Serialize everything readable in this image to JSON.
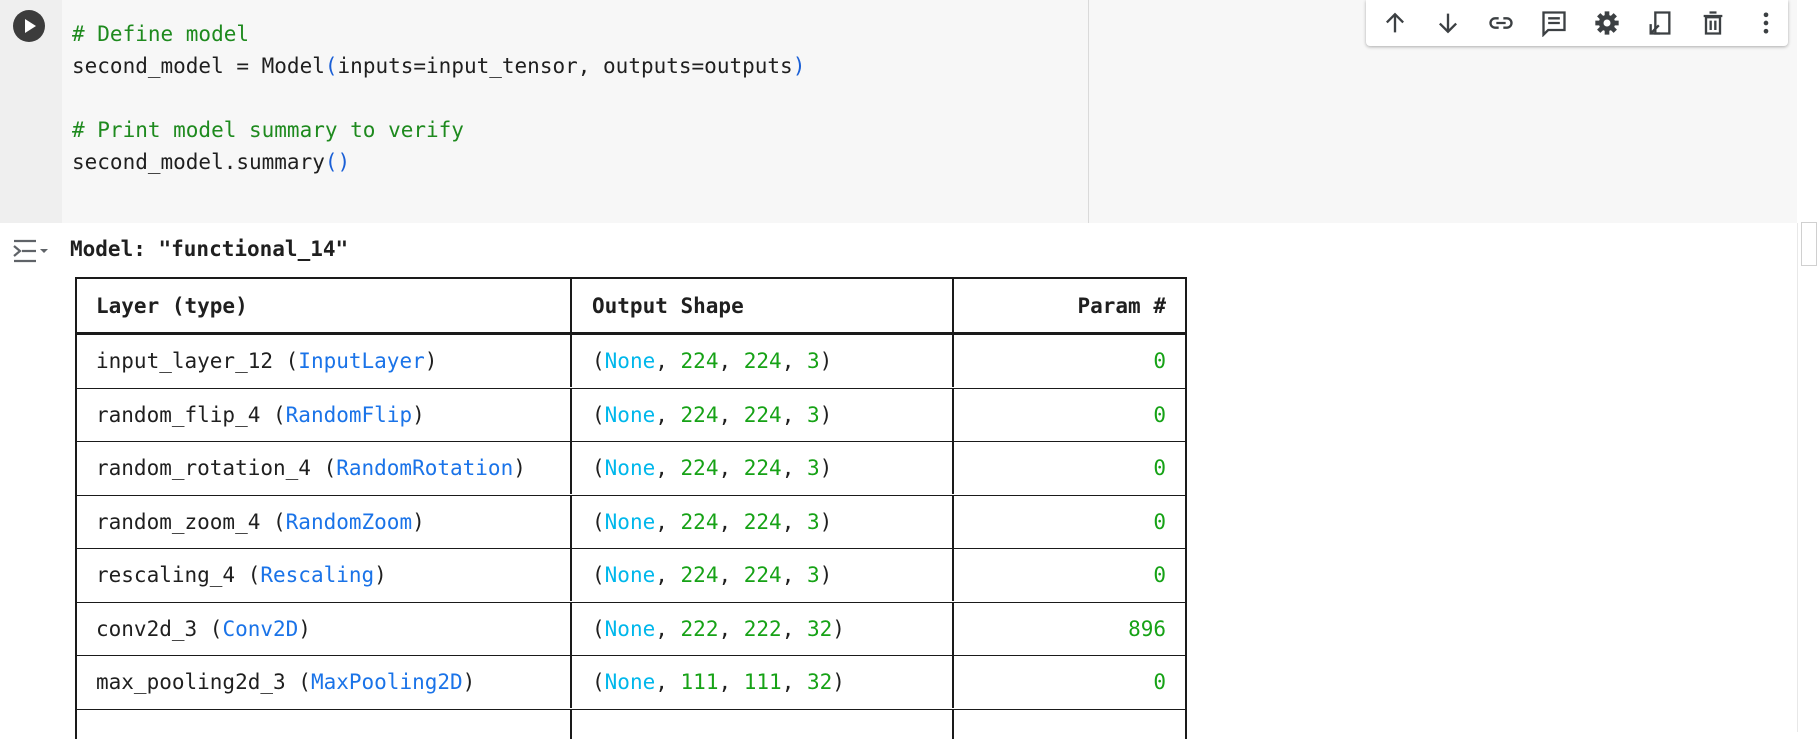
{
  "code_cell": {
    "lines": [
      {
        "comment": "# Define model"
      },
      {
        "pre": "second_model = Model",
        "open": "(",
        "args": "inputs=input_tensor, outputs=outputs",
        "close": ")"
      },
      {
        "text": ""
      },
      {
        "comment": "# Print model summary to verify"
      },
      {
        "pre": "second_model.summary",
        "open": "(",
        "close": ")"
      }
    ]
  },
  "toolbar": {
    "icons": [
      "arrow-up-icon",
      "arrow-down-icon",
      "link-icon",
      "comment-icon",
      "gear-icon",
      "mirror-cell-icon",
      "trash-icon",
      "more-vert-icon"
    ]
  },
  "output": {
    "model_title": "Model: \"functional_14\"",
    "columns": [
      "Layer (type)",
      "Output Shape",
      "Param #"
    ],
    "rows": [
      {
        "name": "input_layer_12",
        "type": "InputLayer",
        "shape": [
          "None",
          "224",
          "224",
          "3"
        ],
        "params": "0"
      },
      {
        "name": "random_flip_4",
        "type": "RandomFlip",
        "shape": [
          "None",
          "224",
          "224",
          "3"
        ],
        "params": "0"
      },
      {
        "name": "random_rotation_4",
        "type": "RandomRotation",
        "shape": [
          "None",
          "224",
          "224",
          "3"
        ],
        "params": "0"
      },
      {
        "name": "random_zoom_4",
        "type": "RandomZoom",
        "shape": [
          "None",
          "224",
          "224",
          "3"
        ],
        "params": "0"
      },
      {
        "name": "rescaling_4",
        "type": "Rescaling",
        "shape": [
          "None",
          "224",
          "224",
          "3"
        ],
        "params": "0"
      },
      {
        "name": "conv2d_3",
        "type": "Conv2D",
        "shape": [
          "None",
          "222",
          "222",
          "32"
        ],
        "params": "896"
      },
      {
        "name": "max_pooling2d_3",
        "type": "MaxPooling2D",
        "shape": [
          "None",
          "111",
          "111",
          "32"
        ],
        "params": "0"
      }
    ]
  },
  "colors": {
    "comment": "#1e8a1e",
    "paren": "#1a5fd6",
    "layer_type": "#1a73e8",
    "none_keyword": "#00b7eb",
    "number": "#16a216"
  }
}
